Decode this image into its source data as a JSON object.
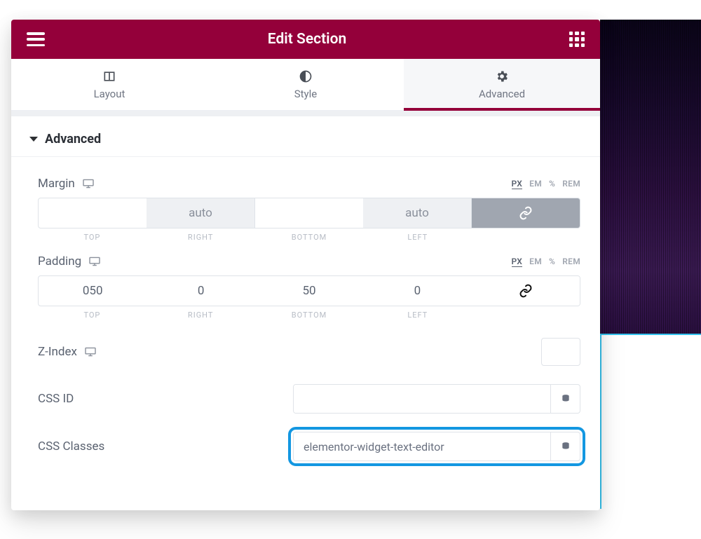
{
  "header": {
    "title": "Edit Section"
  },
  "tabs": {
    "layout": "Layout",
    "style": "Style",
    "advanced": "Advanced"
  },
  "section": {
    "title": "Advanced"
  },
  "margin": {
    "label": "Margin",
    "values": {
      "top": "",
      "right": "auto",
      "bottom": "",
      "left": "auto"
    },
    "sub": {
      "top": "TOP",
      "right": "RIGHT",
      "bottom": "BOTTOM",
      "left": "LEFT"
    },
    "units": {
      "px": "PX",
      "em": "EM",
      "pct": "%",
      "rem": "REM"
    }
  },
  "padding": {
    "label": "Padding",
    "values": {
      "top": "050",
      "right": "0",
      "bottom": "50",
      "left": "0"
    },
    "sub": {
      "top": "TOP",
      "right": "RIGHT",
      "bottom": "BOTTOM",
      "left": "LEFT"
    },
    "units": {
      "px": "PX",
      "em": "EM",
      "pct": "%",
      "rem": "REM"
    }
  },
  "zindex": {
    "label": "Z-Index",
    "value": ""
  },
  "cssid": {
    "label": "CSS ID",
    "value": ""
  },
  "cssclasses": {
    "label": "CSS Classes",
    "value": "elementor-widget-text-editor"
  }
}
